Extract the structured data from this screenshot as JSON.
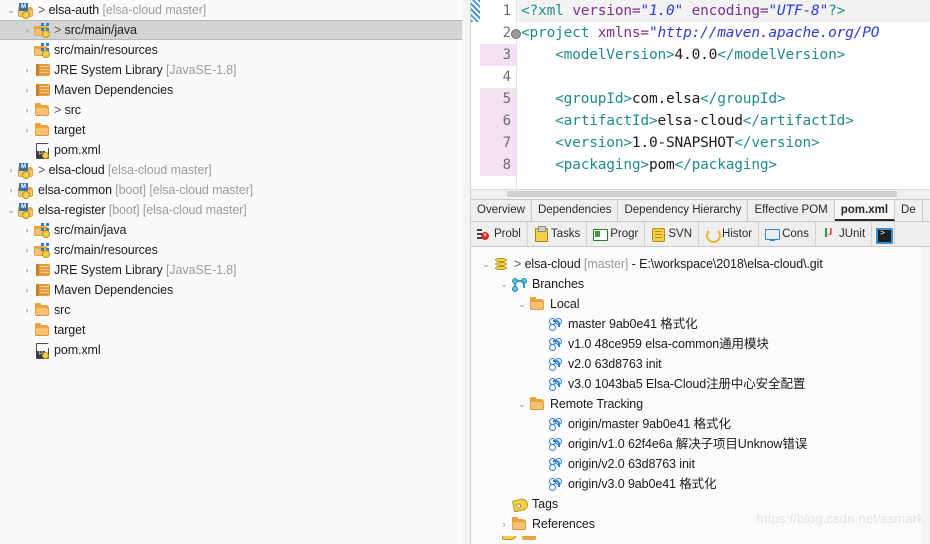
{
  "explorer": {
    "name": "package-explorer",
    "items": [
      {
        "indent": 0,
        "twisty": "down",
        "icon": "maven-project-icon",
        "label": "elsa-auth",
        "prefix": "> ",
        "suffix": " [elsa-cloud master]",
        "selected": false
      },
      {
        "indent": 1,
        "twisty": "right",
        "icon": "source-folder-icon",
        "label": "src/main/java",
        "prefix": "> ",
        "suffix": "",
        "selected": true
      },
      {
        "indent": 1,
        "twisty": "none",
        "icon": "source-folder-icon",
        "label": "src/main/resources",
        "prefix": "",
        "suffix": "",
        "selected": false
      },
      {
        "indent": 1,
        "twisty": "right",
        "icon": "library-icon",
        "label": "JRE System Library",
        "prefix": "",
        "suffix": " [JavaSE-1.8]",
        "selected": false
      },
      {
        "indent": 1,
        "twisty": "right",
        "icon": "library-icon",
        "label": "Maven Dependencies",
        "prefix": "",
        "suffix": "",
        "selected": false
      },
      {
        "indent": 1,
        "twisty": "right",
        "icon": "folder-icon",
        "label": "src",
        "prefix": "> ",
        "suffix": "",
        "selected": false
      },
      {
        "indent": 1,
        "twisty": "right",
        "icon": "folder-icon",
        "label": "target",
        "prefix": "",
        "suffix": "",
        "selected": false
      },
      {
        "indent": 1,
        "twisty": "none",
        "icon": "xml-file-icon",
        "label": "pom.xml",
        "prefix": "",
        "suffix": "",
        "selected": false
      },
      {
        "indent": 0,
        "twisty": "right",
        "icon": "maven-project-icon",
        "label": "elsa-cloud",
        "prefix": "> ",
        "suffix": " [elsa-cloud master]",
        "selected": false
      },
      {
        "indent": 0,
        "twisty": "right",
        "icon": "maven-project-icon",
        "label": "elsa-common",
        "prefix": "",
        "suffix": " [boot] [elsa-cloud master]",
        "selected": false
      },
      {
        "indent": 0,
        "twisty": "down",
        "icon": "maven-project-icon",
        "label": "elsa-register",
        "prefix": "",
        "suffix": " [boot] [elsa-cloud master]",
        "selected": false
      },
      {
        "indent": 1,
        "twisty": "right",
        "icon": "source-folder-icon",
        "label": "src/main/java",
        "prefix": "",
        "suffix": "",
        "selected": false
      },
      {
        "indent": 1,
        "twisty": "right",
        "icon": "source-folder-icon",
        "label": "src/main/resources",
        "prefix": "",
        "suffix": "",
        "selected": false
      },
      {
        "indent": 1,
        "twisty": "right",
        "icon": "library-icon",
        "label": "JRE System Library",
        "prefix": "",
        "suffix": " [JavaSE-1.8]",
        "selected": false
      },
      {
        "indent": 1,
        "twisty": "right",
        "icon": "library-icon",
        "label": "Maven Dependencies",
        "prefix": "",
        "suffix": "",
        "selected": false
      },
      {
        "indent": 1,
        "twisty": "right",
        "icon": "folder-icon",
        "label": "src",
        "prefix": "",
        "suffix": "",
        "selected": false
      },
      {
        "indent": 1,
        "twisty": "none",
        "icon": "folder-icon",
        "label": "target",
        "prefix": "",
        "suffix": "",
        "selected": false
      },
      {
        "indent": 1,
        "twisty": "none",
        "icon": "xml-file-icon",
        "label": "pom.xml",
        "prefix": "",
        "suffix": "",
        "selected": false
      }
    ]
  },
  "editor": {
    "name": "pom-xml-editor",
    "lines": [
      {
        "num": "1",
        "changed": false,
        "current": true,
        "fold": false,
        "segments": [
          {
            "t": "pi",
            "s": "<?xml "
          },
          {
            "t": "attr",
            "s": "version="
          },
          {
            "t": "val",
            "s": "\"1.0\""
          },
          {
            "t": "pi",
            "s": " "
          },
          {
            "t": "attr",
            "s": "encoding="
          },
          {
            "t": "val",
            "s": "\"UTF-8\""
          },
          {
            "t": "pi",
            "s": "?>"
          }
        ]
      },
      {
        "num": "2",
        "changed": false,
        "current": false,
        "fold": true,
        "segments": [
          {
            "t": "tag",
            "s": "<project "
          },
          {
            "t": "attr",
            "s": "xmlns="
          },
          {
            "t": "val",
            "s": "\"http://maven.apache.org/PO"
          }
        ]
      },
      {
        "num": "3",
        "changed": true,
        "current": false,
        "fold": false,
        "segments": [
          {
            "t": "txt",
            "s": "    "
          },
          {
            "t": "tag",
            "s": "<modelVersion>"
          },
          {
            "t": "txt",
            "s": "4.0.0"
          },
          {
            "t": "tag",
            "s": "</modelVersion>"
          }
        ]
      },
      {
        "num": "4",
        "changed": false,
        "current": false,
        "fold": false,
        "segments": [
          {
            "t": "txt",
            "s": ""
          }
        ]
      },
      {
        "num": "5",
        "changed": true,
        "current": false,
        "fold": false,
        "segments": [
          {
            "t": "txt",
            "s": "    "
          },
          {
            "t": "tag",
            "s": "<groupId>"
          },
          {
            "t": "txt",
            "s": "com.elsa"
          },
          {
            "t": "tag",
            "s": "</groupId>"
          }
        ]
      },
      {
        "num": "6",
        "changed": true,
        "current": false,
        "fold": false,
        "segments": [
          {
            "t": "txt",
            "s": "    "
          },
          {
            "t": "tag",
            "s": "<artifactId>"
          },
          {
            "t": "txt",
            "s": "elsa-cloud"
          },
          {
            "t": "tag",
            "s": "</artifactId>"
          }
        ]
      },
      {
        "num": "7",
        "changed": true,
        "current": false,
        "fold": false,
        "segments": [
          {
            "t": "txt",
            "s": "    "
          },
          {
            "t": "tag",
            "s": "<version>"
          },
          {
            "t": "txt",
            "s": "1.0-SNAPSHOT"
          },
          {
            "t": "tag",
            "s": "</version>"
          }
        ]
      },
      {
        "num": "8",
        "changed": true,
        "current": false,
        "fold": false,
        "segments": [
          {
            "t": "txt",
            "s": "    "
          },
          {
            "t": "tag",
            "s": "<packaging>"
          },
          {
            "t": "txt",
            "s": "pom"
          },
          {
            "t": "tag",
            "s": "</packaging>"
          }
        ]
      }
    ]
  },
  "form_tabs": {
    "name": "pom-editor-form-tabs",
    "items": [
      {
        "label": "Overview",
        "active": false
      },
      {
        "label": "Dependencies",
        "active": false
      },
      {
        "label": "Dependency Hierarchy",
        "active": false
      },
      {
        "label": "Effective POM",
        "active": false
      },
      {
        "label": "pom.xml",
        "active": true
      },
      {
        "label": "De",
        "active": false
      }
    ]
  },
  "view_tabs": {
    "name": "bottom-view-tabs",
    "items": [
      {
        "label": "Probl",
        "icon": "problems-icon"
      },
      {
        "label": "Tasks",
        "icon": "tasks-icon"
      },
      {
        "label": "Progr",
        "icon": "progress-icon"
      },
      {
        "label": "SVN",
        "icon": "svn-icon"
      },
      {
        "label": "Histor",
        "icon": "history-icon"
      },
      {
        "label": "Cons",
        "icon": "console-icon"
      },
      {
        "label": "JUnit",
        "icon": "junit-icon"
      },
      {
        "label": "",
        "icon": "terminal-icon"
      }
    ]
  },
  "git": {
    "name": "git-repositories-view",
    "watermark": "https://blog.csdn.net/ssmark",
    "partial_label": "",
    "items": [
      {
        "indent": 0,
        "twisty": "down",
        "icon": "repository-icon",
        "prefix": "> ",
        "label": "elsa-cloud",
        "dim": " [master]",
        "suffix": " - E:\\workspace\\2018\\elsa-cloud\\.git"
      },
      {
        "indent": 1,
        "twisty": "down",
        "icon": "branches-icon",
        "prefix": "",
        "label": "Branches",
        "dim": "",
        "suffix": ""
      },
      {
        "indent": 2,
        "twisty": "down",
        "icon": "folder-icon",
        "prefix": "",
        "label": "Local",
        "dim": "",
        "suffix": ""
      },
      {
        "indent": 3,
        "twisty": "none",
        "icon": "branch-icon",
        "prefix": "",
        "label": "master 9ab0e41 格式化",
        "dim": "",
        "suffix": ""
      },
      {
        "indent": 3,
        "twisty": "none",
        "icon": "branch-icon",
        "prefix": "",
        "label": "v1.0 48ce959 elsa-common通用模块",
        "dim": "",
        "suffix": ""
      },
      {
        "indent": 3,
        "twisty": "none",
        "icon": "branch-icon",
        "prefix": "",
        "label": "v2.0 63d8763 init",
        "dim": "",
        "suffix": ""
      },
      {
        "indent": 3,
        "twisty": "none",
        "icon": "branch-icon",
        "prefix": "",
        "label": "v3.0 1043ba5 Elsa-Cloud注册中心安全配置",
        "dim": "",
        "suffix": ""
      },
      {
        "indent": 2,
        "twisty": "down",
        "icon": "folder-icon",
        "prefix": "",
        "label": "Remote Tracking",
        "dim": "",
        "suffix": ""
      },
      {
        "indent": 3,
        "twisty": "none",
        "icon": "branch-icon",
        "prefix": "",
        "label": "origin/master 9ab0e41 格式化",
        "dim": "",
        "suffix": ""
      },
      {
        "indent": 3,
        "twisty": "none",
        "icon": "branch-icon",
        "prefix": "",
        "label": "origin/v1.0 62f4e6a 解决子项目Unknow错误",
        "dim": "",
        "suffix": ""
      },
      {
        "indent": 3,
        "twisty": "none",
        "icon": "branch-icon",
        "prefix": "",
        "label": "origin/v2.0 63d8763 init",
        "dim": "",
        "suffix": ""
      },
      {
        "indent": 3,
        "twisty": "none",
        "icon": "branch-icon",
        "prefix": "",
        "label": "origin/v3.0 9ab0e41 格式化",
        "dim": "",
        "suffix": ""
      },
      {
        "indent": 1,
        "twisty": "none",
        "icon": "tag-icon",
        "prefix": "",
        "label": "Tags",
        "dim": "",
        "suffix": ""
      },
      {
        "indent": 1,
        "twisty": "right",
        "icon": "folder-icon",
        "prefix": "",
        "label": "References",
        "dim": "",
        "suffix": ""
      }
    ]
  }
}
